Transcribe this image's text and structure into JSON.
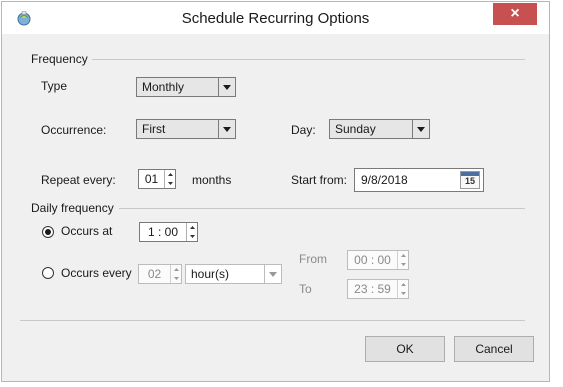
{
  "window": {
    "title": "Schedule Recurring Options",
    "close_symbol": "×"
  },
  "frequency": {
    "group_label": "Frequency",
    "type_label": "Type",
    "type_value": "Monthly",
    "occurrence_label": "Occurrence:",
    "occurrence_value": "First",
    "day_label": "Day:",
    "day_value": "Sunday",
    "repeat_label": "Repeat every:",
    "repeat_value": "01",
    "repeat_unit": "months",
    "start_label": "Start from:",
    "start_value": "9/8/2018",
    "calendar_number": "15"
  },
  "daily": {
    "group_label": "Daily frequency",
    "occurs_at_label": "Occurs at",
    "occurs_at_time": "1 : 00",
    "occurs_every_label": "Occurs every",
    "every_value": "02",
    "every_unit": "hour(s)",
    "from_label": "From",
    "from_time": "00 : 00",
    "to_label": "To",
    "to_time": "23 : 59",
    "selected": "occurs_at"
  },
  "buttons": {
    "ok_label": "OK",
    "cancel_label": "Cancel"
  }
}
